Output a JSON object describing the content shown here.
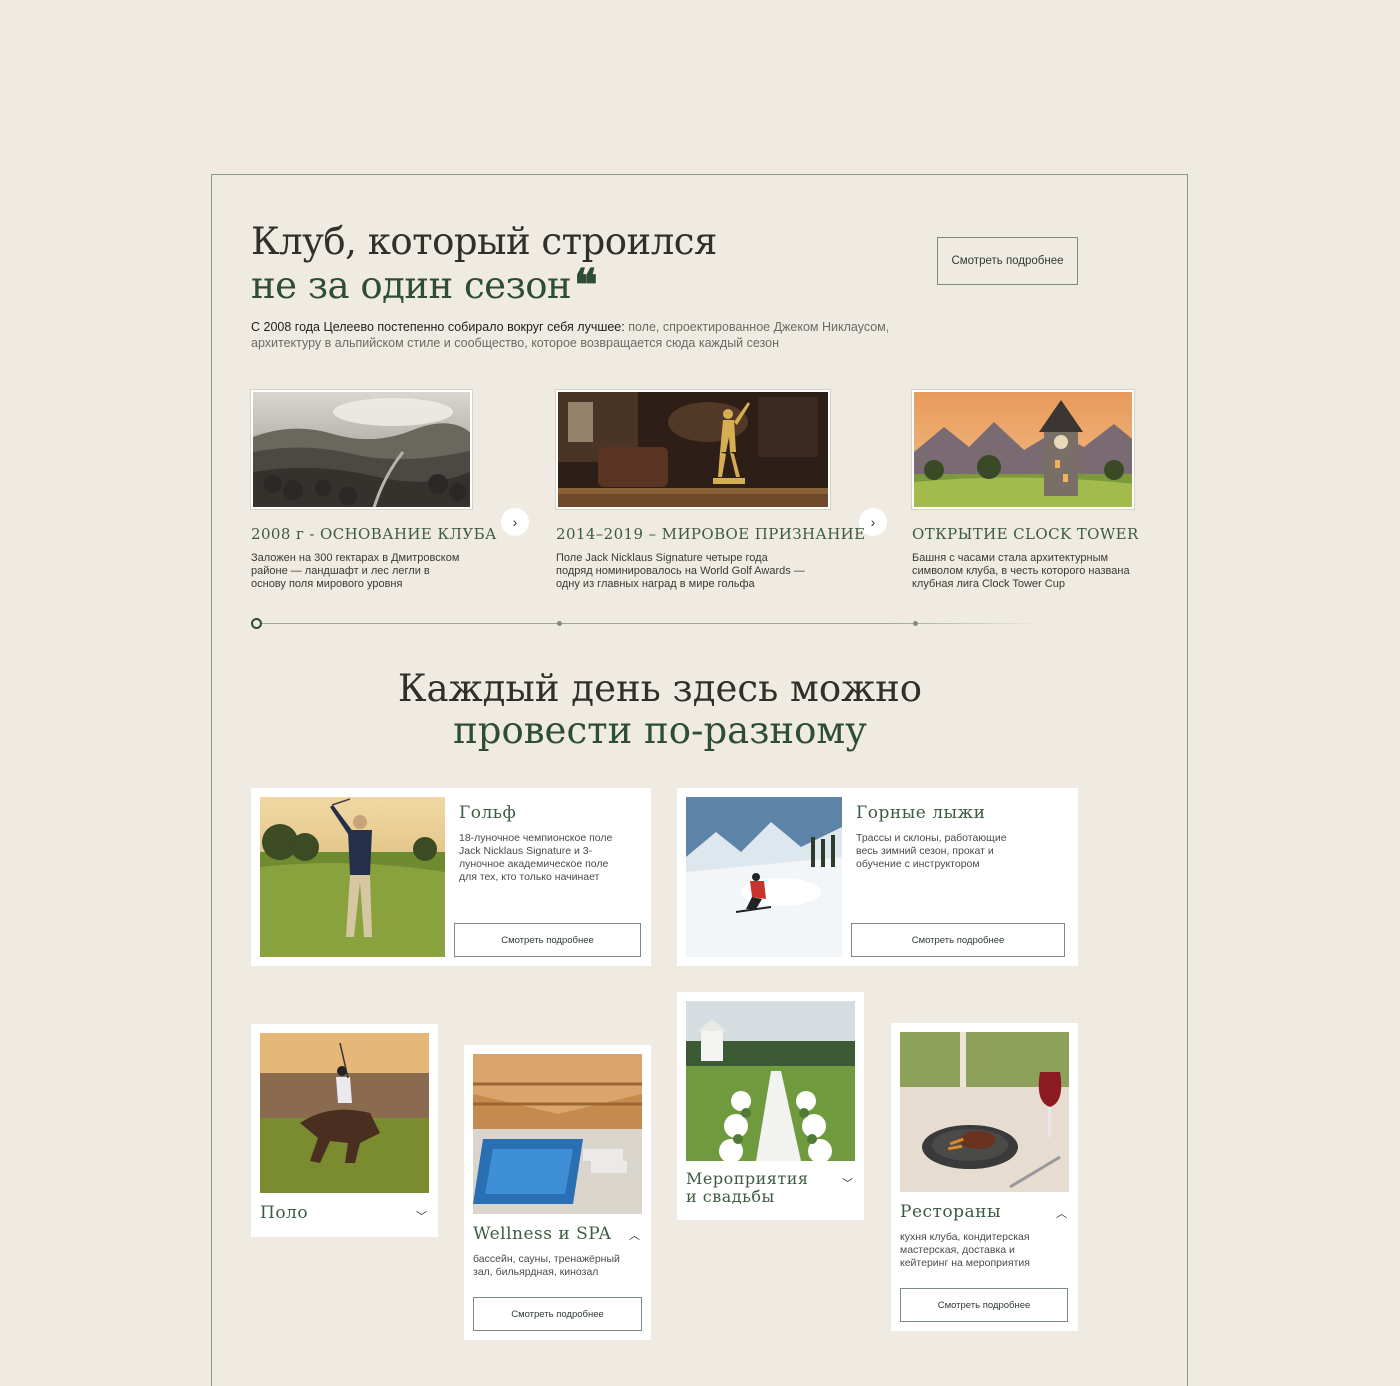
{
  "hero": {
    "title_line1": "Клуб, который строился",
    "title_line2": "не за один сезон",
    "quote_icon": "quote-icon",
    "button_label": "Смотреть подробнее",
    "intro_bold": "С 2008 года Целеево постепенно собирало вокруг себя лучшее:",
    "intro_rest": " поле, спроектированное Джеком Никлаусом, архитектуру в альпийском стиле и сообщество, которое возвращается сюда каждый сезон"
  },
  "timeline": {
    "items": [
      {
        "title": "2008 г - ОСНОВАНИЕ КЛУБА",
        "text": "Заложен на 300 гектарах в Дмитровском районе — ландшафт и лес легли в основу поля мирового уровня",
        "image": "misty-forest-landscape"
      },
      {
        "title": "2014–2019 – МИРОВОЕ ПРИЗНАНИЕ",
        "text": "Поле Jack Nicklaus Signature четыре года подряд номинировалось на World Golf Awards — одну из главных наград в мире гольфа",
        "image": "golden-golfer-trophy"
      },
      {
        "title": "ОТКРЫТИЕ CLOCK TOWER",
        "text": "Башня с часами стала архитектурным символом клуба, в честь которого названа клубная лига Clock Tower Cup",
        "image": "clock-tower-sunset"
      }
    ],
    "next_icon": "chevron-right-icon",
    "active_index": 0
  },
  "activities": {
    "title_line1": "Каждый день здесь можно",
    "title_line2": "провести по-разному",
    "cards": [
      {
        "title": "Гольф",
        "text": "18-луночное чемпионское поле Jack Nicklaus Signature и 3-луночное академическое поле для тех, кто только начинает",
        "button_label": "Смотреть подробнее",
        "image": "golfer-swing"
      },
      {
        "title": "Горные лыжи",
        "text": "Трассы и склоны, работающие весь зимний сезон, прокат и обучение с инструктором",
        "button_label": "Смотреть подробнее",
        "image": "skier-mountains"
      },
      {
        "title": "Поло",
        "image": "polo-rider",
        "chevron": "chevron-down-icon"
      },
      {
        "title": "Wellness и SPA",
        "text": "бассейн, сауны, тренажёрный зал, бильярдная, кинозал",
        "button_label": "Смотреть подробнее",
        "image": "indoor-pool",
        "chevron": "chevron-up-icon"
      },
      {
        "title_line1": "Мероприятия",
        "title_line2": "и свадьбы",
        "image": "wedding-aisle",
        "chevron": "chevron-down-icon"
      },
      {
        "title": "Рестораны",
        "text": "кухня клуба, кондитерская мастерская, доставка и кейтеринг на мероприятия",
        "button_label": "Смотреть подробнее",
        "image": "steak-wine-dinner",
        "chevron": "chevron-up-icon"
      }
    ]
  },
  "colors": {
    "background": "#f0ebe2",
    "accent_green": "#2e4d36",
    "card": "#ffffff"
  }
}
